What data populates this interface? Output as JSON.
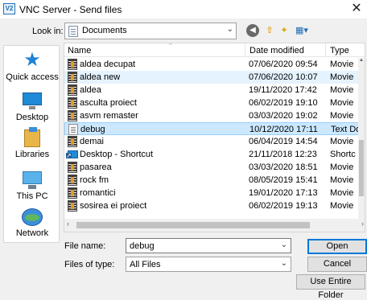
{
  "window": {
    "title": "VNC Server - Send files",
    "app_icon_text": "V2",
    "close_glyph": "✕"
  },
  "toolbar": {
    "look_in_label": "Look in:",
    "look_in_value": "Documents",
    "back_glyph": "◀",
    "up_glyph": "⇧",
    "new_folder_glyph": "✦",
    "view_glyph": "▦▾"
  },
  "places": [
    {
      "label": "Quick access",
      "icon": "quick-access-icon"
    },
    {
      "label": "Desktop",
      "icon": "desktop-icon"
    },
    {
      "label": "Libraries",
      "icon": "libraries-icon"
    },
    {
      "label": "This PC",
      "icon": "this-pc-icon"
    },
    {
      "label": "Network",
      "icon": "network-icon"
    }
  ],
  "file_list": {
    "columns": {
      "name": "Name",
      "date": "Date modified",
      "type": "Type"
    },
    "rows": [
      {
        "name": "aldea decupat",
        "date": "07/06/2020 09:54",
        "type": "Movie",
        "icon": "movie"
      },
      {
        "name": "aldea new",
        "date": "07/06/2020 10:07",
        "type": "Movie",
        "icon": "movie",
        "state": "hover"
      },
      {
        "name": "aldea",
        "date": "19/11/2020 17:42",
        "type": "Movie",
        "icon": "movie"
      },
      {
        "name": "asculta proiect",
        "date": "06/02/2019 19:10",
        "type": "Movie",
        "icon": "movie"
      },
      {
        "name": "asvm remaster",
        "date": "03/03/2020 19:02",
        "type": "Movie",
        "icon": "movie"
      },
      {
        "name": "debug",
        "date": "10/12/2020 17:11",
        "type": "Text Do",
        "icon": "text",
        "state": "selected"
      },
      {
        "name": "demai",
        "date": "06/04/2019 14:54",
        "type": "Movie",
        "icon": "movie"
      },
      {
        "name": "Desktop - Shortcut",
        "date": "21/11/2018 12:23",
        "type": "Shortc",
        "icon": "shortcut"
      },
      {
        "name": "pasarea",
        "date": "03/03/2020 18:51",
        "type": "Movie",
        "icon": "movie"
      },
      {
        "name": "rock fm",
        "date": "08/05/2019 15:41",
        "type": "Movie",
        "icon": "movie"
      },
      {
        "name": "romantici",
        "date": "19/01/2020 17:13",
        "type": "Movie",
        "icon": "movie"
      },
      {
        "name": "sosirea ei proiect",
        "date": "06/02/2019 19:13",
        "type": "Movie",
        "icon": "movie"
      }
    ]
  },
  "form": {
    "file_name_label": "File name:",
    "file_name_value": "debug",
    "file_type_label": "Files of type:",
    "file_type_value": "All Files"
  },
  "buttons": {
    "open": "Open",
    "cancel": "Cancel",
    "entire_folder": "Use Entire Folder"
  },
  "colors": {
    "selection": "#cce8ff",
    "hover": "#e5f3ff",
    "accent": "#0078d7"
  }
}
